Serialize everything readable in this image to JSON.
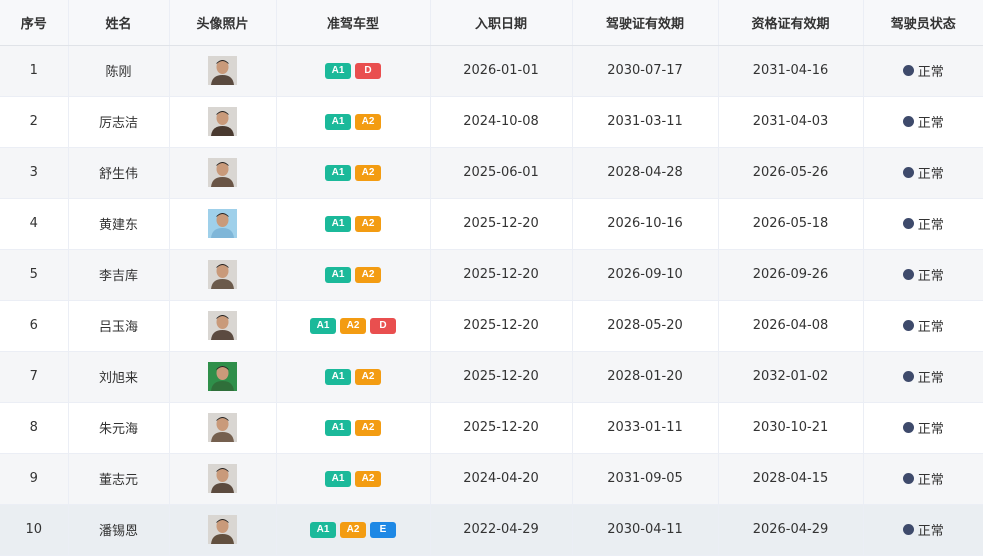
{
  "columns": [
    "序号",
    "姓名",
    "头像照片",
    "准驾车型",
    "入职日期",
    "驾驶证有效期",
    "资格证有效期",
    "驾驶员状态"
  ],
  "colors": {
    "A1": "#1bb99a",
    "A2": "#f39c12",
    "D": "#e94f4f",
    "E": "#1e88e5",
    "status_dot": "#3e4a6b"
  },
  "rows": [
    {
      "no": "1",
      "name": "陈刚",
      "avatar": "driver-photo",
      "licenses": [
        "A1",
        "D"
      ],
      "hire_date": "2026-01-01",
      "license_expiry": "2030-07-17",
      "cert_expiry": "2031-04-16",
      "status": "正常"
    },
    {
      "no": "2",
      "name": "厉志洁",
      "avatar": "driver-photo",
      "licenses": [
        "A1",
        "A2"
      ],
      "hire_date": "2024-10-08",
      "license_expiry": "2031-03-11",
      "cert_expiry": "2031-04-03",
      "status": "正常"
    },
    {
      "no": "3",
      "name": "舒生伟",
      "avatar": "driver-photo",
      "licenses": [
        "A1",
        "A2"
      ],
      "hire_date": "2025-06-01",
      "license_expiry": "2028-04-28",
      "cert_expiry": "2026-05-26",
      "status": "正常"
    },
    {
      "no": "4",
      "name": "黄建东",
      "avatar": "driver-photo",
      "licenses": [
        "A1",
        "A2"
      ],
      "hire_date": "2025-12-20",
      "license_expiry": "2026-10-16",
      "cert_expiry": "2026-05-18",
      "status": "正常"
    },
    {
      "no": "5",
      "name": "李吉库",
      "avatar": "driver-photo",
      "licenses": [
        "A1",
        "A2"
      ],
      "hire_date": "2025-12-20",
      "license_expiry": "2026-09-10",
      "cert_expiry": "2026-09-26",
      "status": "正常"
    },
    {
      "no": "6",
      "name": "吕玉海",
      "avatar": "driver-photo",
      "licenses": [
        "A1",
        "A2",
        "D"
      ],
      "hire_date": "2025-12-20",
      "license_expiry": "2028-05-20",
      "cert_expiry": "2026-04-08",
      "status": "正常"
    },
    {
      "no": "7",
      "name": "刘旭来",
      "avatar": "driver-photo",
      "licenses": [
        "A1",
        "A2"
      ],
      "hire_date": "2025-12-20",
      "license_expiry": "2028-01-20",
      "cert_expiry": "2032-01-02",
      "status": "正常"
    },
    {
      "no": "8",
      "name": "朱元海",
      "avatar": "driver-photo",
      "licenses": [
        "A1",
        "A2"
      ],
      "hire_date": "2025-12-20",
      "license_expiry": "2033-01-11",
      "cert_expiry": "2030-10-21",
      "status": "正常"
    },
    {
      "no": "9",
      "name": "董志元",
      "avatar": "driver-photo",
      "licenses": [
        "A1",
        "A2"
      ],
      "hire_date": "2024-04-20",
      "license_expiry": "2031-09-05",
      "cert_expiry": "2028-04-15",
      "status": "正常"
    },
    {
      "no": "10",
      "name": "潘锡恩",
      "avatar": "driver-photo",
      "licenses": [
        "A1",
        "A2",
        "E"
      ],
      "hire_date": "2022-04-29",
      "license_expiry": "2030-04-11",
      "cert_expiry": "2026-04-29",
      "status": "正常"
    }
  ]
}
